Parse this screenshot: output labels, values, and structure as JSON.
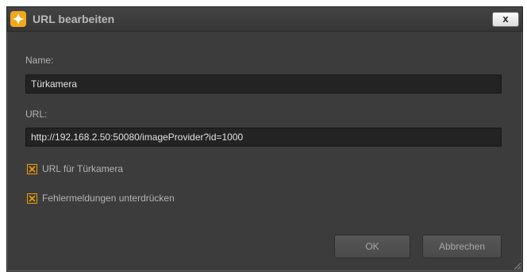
{
  "window": {
    "title": "URL bearbeiten",
    "close_label": "x"
  },
  "form": {
    "name_label": "Name:",
    "name_value": "Türkamera",
    "url_label": "URL:",
    "url_value": "http://192.168.2.50:50080/imageProvider?id=1000"
  },
  "options": [
    {
      "label": "URL für Türkamera",
      "checked": true
    },
    {
      "label": "Fehlermeldungen unterdrücken",
      "checked": true
    }
  ],
  "buttons": {
    "ok_label": "OK",
    "cancel_label": "Abbrechen"
  },
  "colors": {
    "accent": "#f0a000",
    "background": "#3c3c3c",
    "field_background": "#232323"
  },
  "icons": {
    "app": "app-logo-icon",
    "check": "checkmark-x-icon",
    "resize": "resize-grip-icon"
  }
}
